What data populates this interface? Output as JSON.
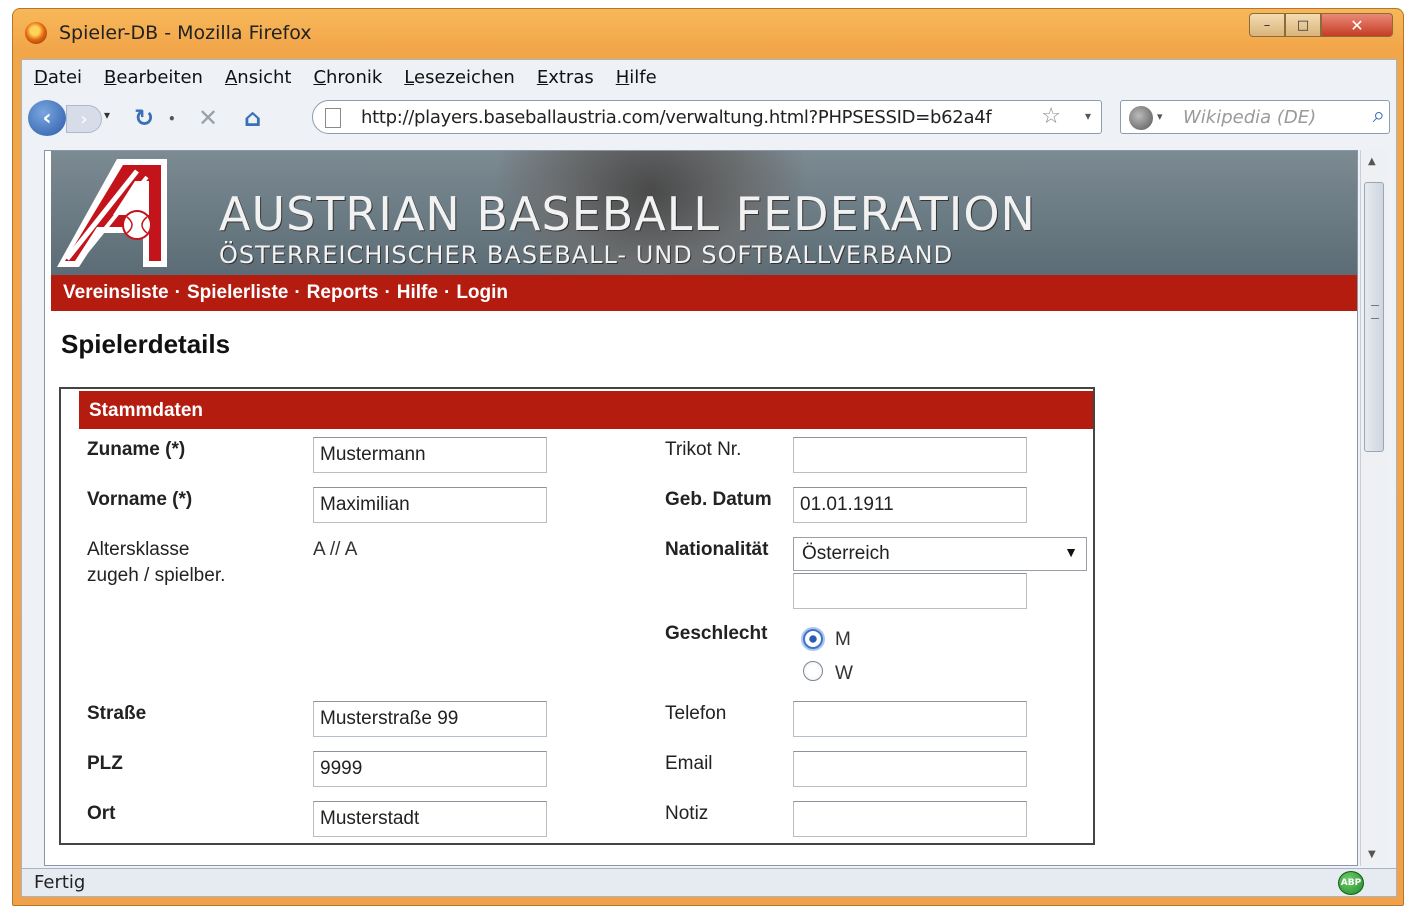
{
  "window": {
    "title": "Spieler-DB - Mozilla Firefox",
    "controls": {
      "minimize": "–",
      "maximize": "□",
      "close": "✕"
    }
  },
  "menu": [
    "Datei",
    "Bearbeiten",
    "Ansicht",
    "Chronik",
    "Lesezeichen",
    "Extras",
    "Hilfe"
  ],
  "toolbar": {
    "url": "http://players.baseballaustria.com/verwaltung.html?PHPSESSID=b62a4f",
    "search_placeholder": "Wikipedia (DE)",
    "icons": [
      "back-icon",
      "forward-icon",
      "reload-icon",
      "stop-icon",
      "home-icon",
      "page-icon",
      "bookmark-star-icon",
      "wikipedia-icon",
      "search-icon"
    ]
  },
  "banner": {
    "title": "AUSTRIAN BASEBALL FEDERATION",
    "subtitle": "ÖSTERREICHISCHER BASEBALL- UND SOFTBALLVERBAND"
  },
  "site_nav": [
    "Vereinsliste",
    "Spielerliste",
    "Reports",
    "Hilfe",
    "Login"
  ],
  "site_nav_separator": "·",
  "page_title": "Spielerdetails",
  "form": {
    "section_title": "Stammdaten",
    "zuname": {
      "label": "Zuname (*)",
      "value": "Mustermann"
    },
    "vorname": {
      "label": "Vorname (*)",
      "value": "Maximilian"
    },
    "altersklasse": {
      "label_line1": "Altersklasse",
      "label_line2": "zugeh / spielber.",
      "value": "A // A"
    },
    "strasse": {
      "label": "Straße",
      "value": "Musterstraße 99"
    },
    "plz": {
      "label": "PLZ",
      "value": "9999"
    },
    "ort": {
      "label": "Ort",
      "value": "Musterstadt"
    },
    "trikot": {
      "label": "Trikot Nr.",
      "value": ""
    },
    "geb_datum": {
      "label": "Geb. Datum",
      "value": "01.01.1911"
    },
    "nationalitaet": {
      "label": "Nationalität",
      "value": "Österreich",
      "extra": ""
    },
    "geschlecht": {
      "label": "Geschlecht",
      "options": [
        "M",
        "W"
      ],
      "selected": "M"
    },
    "telefon": {
      "label": "Telefon",
      "value": ""
    },
    "email": {
      "label": "Email",
      "value": ""
    },
    "notiz": {
      "label": "Notiz",
      "value": ""
    }
  },
  "status": {
    "text": "Fertig",
    "addon_badge": "ABP"
  },
  "colors": {
    "brand_red": "#b51c10",
    "window_orange": "#f2a64a"
  }
}
